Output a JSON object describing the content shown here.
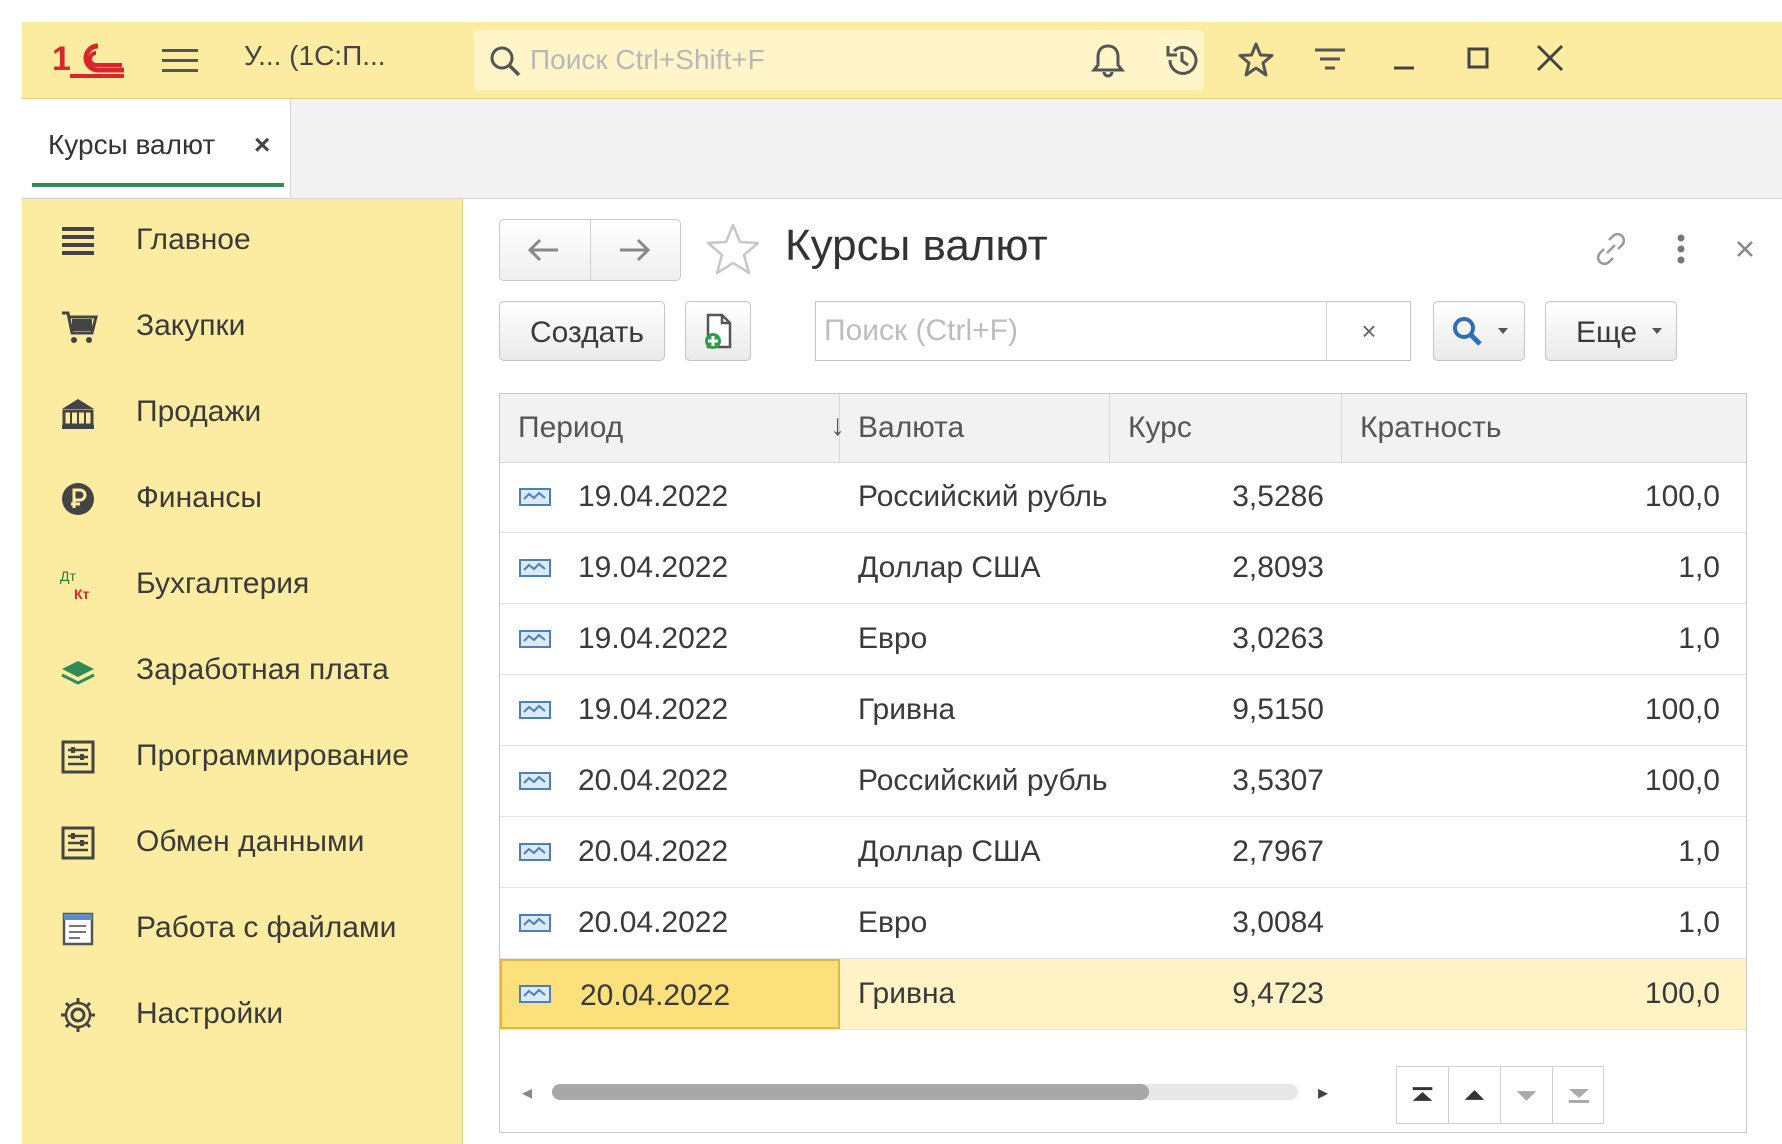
{
  "window": {
    "title": "У... (1С:П...",
    "search_placeholder": "Поиск Ctrl+Shift+F",
    "icons": [
      "logo-1c",
      "menu-icon",
      "search-icon",
      "bell-icon",
      "history-icon",
      "star-icon",
      "filter-icon",
      "minimize-icon",
      "maximize-icon",
      "close-icon"
    ]
  },
  "tabs": [
    {
      "label": "Курсы валют",
      "close": "×"
    }
  ],
  "sidebar": {
    "items": [
      {
        "label": "Главное",
        "icon": "main-menu-icon"
      },
      {
        "label": "Закупки",
        "icon": "purchases-icon"
      },
      {
        "label": "Продажи",
        "icon": "sales-icon"
      },
      {
        "label": "Финансы",
        "icon": "finance-icon"
      },
      {
        "label": "Бухгалтерия",
        "icon": "accounting-icon"
      },
      {
        "label": "Заработная плата",
        "icon": "salary-icon"
      },
      {
        "label": "Программирование",
        "icon": "programming-icon"
      },
      {
        "label": "Обмен данными",
        "icon": "data-exchange-icon"
      },
      {
        "label": "Работа с файлами",
        "icon": "files-icon"
      },
      {
        "label": "Настройки",
        "icon": "settings-icon"
      }
    ]
  },
  "form": {
    "title": "Курсы валют",
    "create_label": "Создать",
    "search_placeholder": "Поиск (Ctrl+F)",
    "search_clear": "×",
    "more_label": "Еще",
    "columns": [
      "Период",
      "Валюта",
      "Курс",
      "Кратность"
    ],
    "sort_indicator": "↓",
    "rows": [
      {
        "period": "19.04.2022",
        "currency": "Российский рубль",
        "rate": "3,5286",
        "multiplier": "100,0"
      },
      {
        "period": "19.04.2022",
        "currency": "Доллар США",
        "rate": "2,8093",
        "multiplier": "1,0"
      },
      {
        "period": "19.04.2022",
        "currency": "Евро",
        "rate": "3,0263",
        "multiplier": "1,0"
      },
      {
        "period": "19.04.2022",
        "currency": "Гривна",
        "rate": "9,5150",
        "multiplier": "100,0"
      },
      {
        "period": "20.04.2022",
        "currency": "Российский рубль",
        "rate": "3,5307",
        "multiplier": "100,0"
      },
      {
        "period": "20.04.2022",
        "currency": "Доллар США",
        "rate": "2,7967",
        "multiplier": "1,0"
      },
      {
        "period": "20.04.2022",
        "currency": "Евро",
        "rate": "3,0084",
        "multiplier": "1,0"
      },
      {
        "period": "20.04.2022",
        "currency": "Гривна",
        "rate": "9,4723",
        "multiplier": "100,0"
      }
    ],
    "selected_row": 7,
    "horizontal_scroll_fraction": 0.8
  },
  "colors": {
    "panel_yellow": "#fbeca1",
    "selected_row": "#fff3c6",
    "selected_cell": "#fbe07c",
    "accent_red": "#d8262b",
    "tab_underline": "#2e8b57"
  }
}
